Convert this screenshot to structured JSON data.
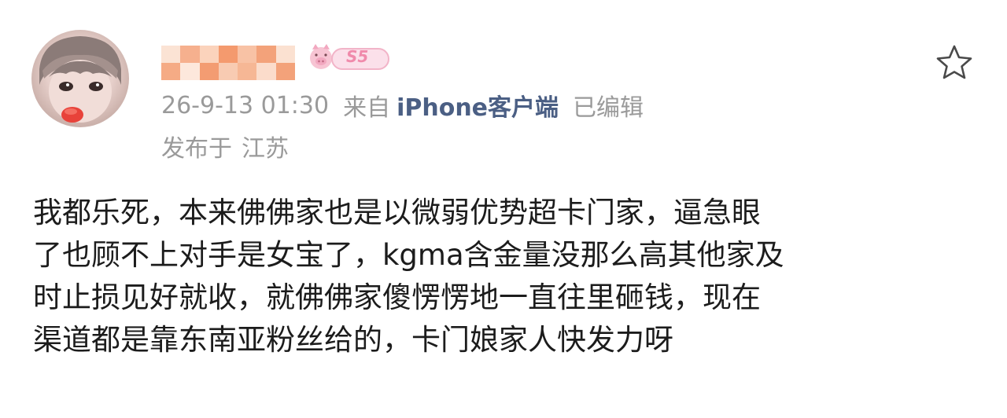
{
  "post": {
    "timestamp": "26-9-13 01:30",
    "source_prefix": "来自",
    "source_client": "iPhone客户端",
    "edited_label": "已编辑",
    "location_prefix": "发布于",
    "location": "江苏",
    "badge_text": "S5",
    "body_lines": [
      "我都乐死，本来佛佛家也是以微弱优势超卡门家，逼急眼",
      "了也顾不上对手是女宝了，kgma含金量没那么高其他家及",
      "时止损见好就收，就佛佛家傻愣愣地一直往里砸钱，现在",
      "渠道都是靠东南亚粉丝给的，卡门娘家人快发力呀"
    ]
  },
  "icons": {
    "favorite": "star-outline-icon",
    "badge": "pig-badge-icon"
  },
  "colors": {
    "meta_gray": "#9a9a9a",
    "client_blue": "#4b5f84",
    "body_text": "#1c1c1c",
    "blur_orange": "#f3a27a",
    "badge_pink": "#f2a8c0"
  }
}
